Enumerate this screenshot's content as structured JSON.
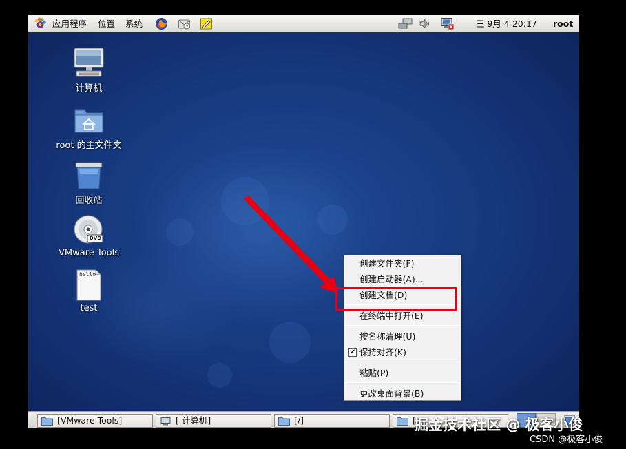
{
  "top_panel": {
    "menu_applications": "应用程序",
    "menu_places": "位置",
    "menu_system": "系统",
    "clock": "三 9月  4 20:17",
    "user": "root",
    "icons": [
      "gnome-foot-icon",
      "firefox-icon",
      "mail-icon",
      "notes-icon",
      "network-icon",
      "volume-icon",
      "network-disconnected-icon"
    ]
  },
  "desktop": {
    "icons": [
      {
        "label": "计算机",
        "icon": "computer-icon"
      },
      {
        "label": "root 的主文件夹",
        "icon": "home-folder-icon"
      },
      {
        "label": "回收站",
        "icon": "trash-icon"
      },
      {
        "label": "VMware Tools",
        "icon": "dvd-icon",
        "badge": "DVD"
      },
      {
        "label": "test",
        "icon": "text-file-icon",
        "preview": "hello"
      }
    ]
  },
  "context_menu": {
    "items": [
      {
        "label": "创建文件夹(F)"
      },
      {
        "label": "创建启动器(A)..."
      },
      {
        "label": "创建文档(D)",
        "submenu": true
      },
      {
        "label": "在终端中打开(E)",
        "highlighted": true
      },
      {
        "label": "按名称清理(U)"
      },
      {
        "label": "保持对齐(K)",
        "checked": true
      },
      {
        "label": "粘贴(P)"
      },
      {
        "label": "更改桌面背景(B)"
      }
    ],
    "chevron": "›",
    "checkmark": "✔"
  },
  "bottom_panel": {
    "tasks": [
      {
        "label": "[VMware Tools]"
      },
      {
        "label": "[ 计算机]"
      },
      {
        "label": "[/]"
      },
      {
        "label": "["
      }
    ]
  },
  "annotation": {
    "color": "#e60012"
  },
  "watermark": {
    "main": "掘金技术社区 @ 极客小俊",
    "csdn": "CSDN @极客小俊"
  }
}
